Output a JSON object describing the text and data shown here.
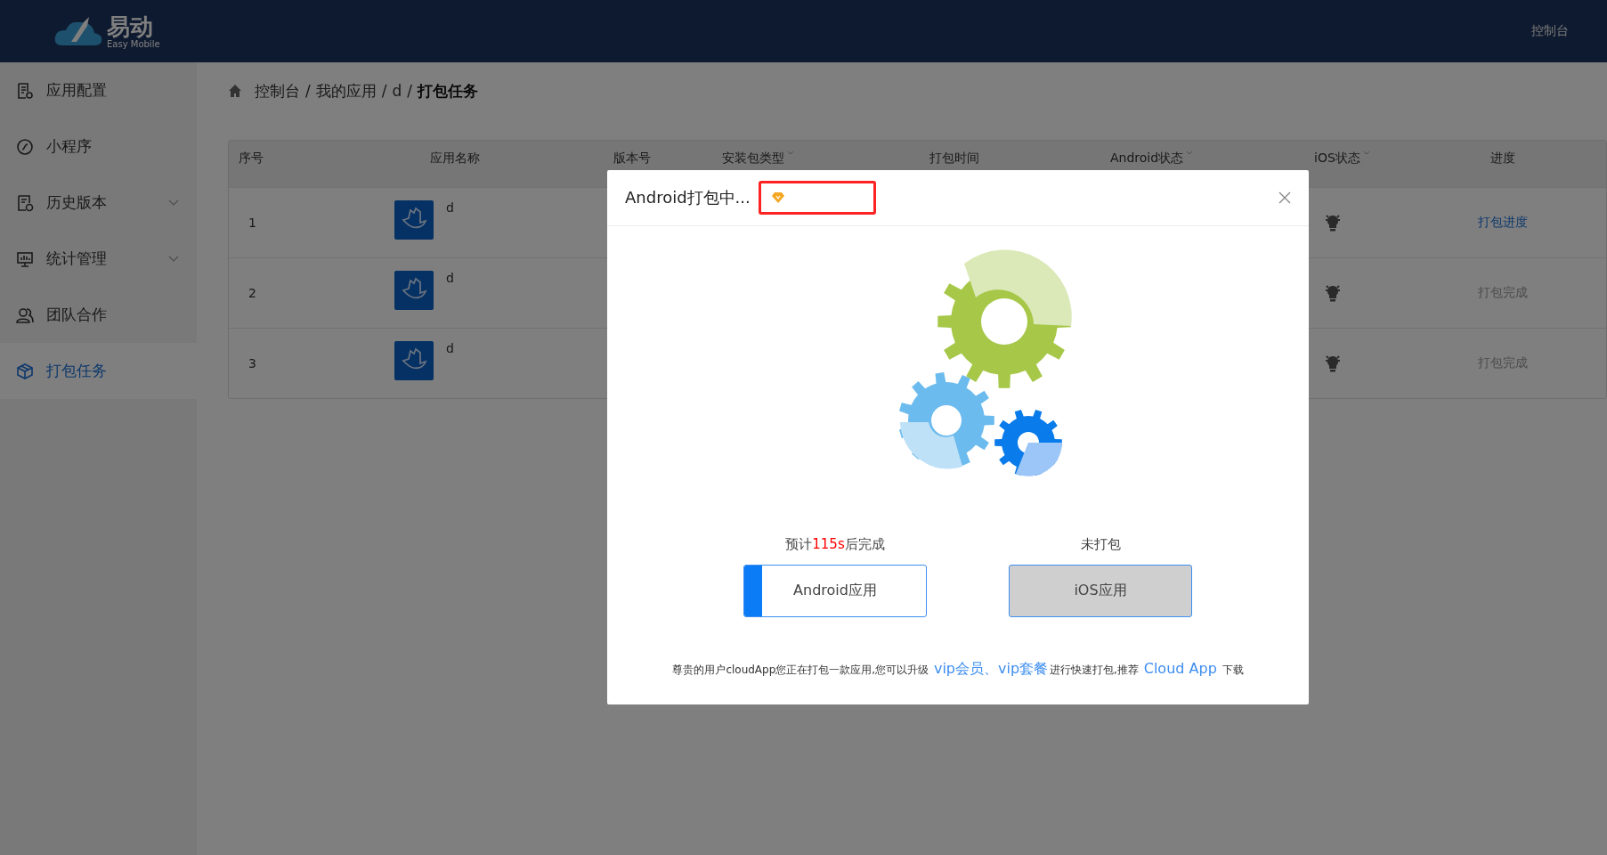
{
  "header": {
    "logo_title": "易动",
    "logo_subtitle": "Easy Mobile",
    "nav": [
      "控制台"
    ]
  },
  "sidebar": {
    "items": [
      {
        "label": "应用配置",
        "expandable": false,
        "selected": false
      },
      {
        "label": "小程序",
        "expandable": false,
        "selected": false
      },
      {
        "label": "历史版本",
        "expandable": true,
        "selected": false
      },
      {
        "label": "统计管理",
        "expandable": true,
        "selected": false
      },
      {
        "label": "团队合作",
        "expandable": false,
        "selected": false
      },
      {
        "label": "打包任务",
        "expandable": false,
        "selected": true
      }
    ]
  },
  "breadcrumb": {
    "separator": "/",
    "items": [
      "控制台",
      "我的应用",
      "d"
    ],
    "current": "打包任务"
  },
  "table": {
    "columns": [
      {
        "label": "序号",
        "sortable": false
      },
      {
        "label": "应用名称",
        "sortable": false
      },
      {
        "label": "版本号",
        "sortable": false
      },
      {
        "label": "安装包类型",
        "sortable": true
      },
      {
        "label": "打包时间",
        "sortable": false
      },
      {
        "label": "Android状态",
        "sortable": true
      },
      {
        "label": "iOS状态",
        "sortable": true
      },
      {
        "label": "进度",
        "sortable": false
      }
    ],
    "rows": [
      {
        "index": "1",
        "app_name": "d",
        "progress": "打包进度",
        "kind": "link"
      },
      {
        "index": "2",
        "app_name": "d",
        "progress": "打包完成",
        "kind": "done"
      },
      {
        "index": "3",
        "app_name": "d",
        "progress": "打包完成",
        "kind": "done"
      }
    ]
  },
  "modal": {
    "title": "Android打包中...",
    "vip_highlighted": true,
    "platforms": [
      {
        "status": [
          {
            "text": "预计",
            "kind": "plain"
          },
          {
            "text": "115s",
            "kind": "highlight"
          },
          {
            "text": "后完成",
            "kind": "plain"
          }
        ],
        "label": "Android应用",
        "level": 0.1,
        "disabled": false
      },
      {
        "status": [
          {
            "text": "未打包",
            "kind": "plain"
          }
        ],
        "label": "iOS应用",
        "disabled": true
      }
    ],
    "footer": [
      {
        "text": "尊贵的用户cloudApp您正在打包一款应用,您可以升级 ",
        "kind": "text"
      },
      {
        "text": "vip会员、vip套餐",
        "kind": "link"
      },
      {
        "text": "进行快速打包,推荐 ",
        "kind": "text"
      },
      {
        "text": "Cloud App",
        "kind": "link"
      },
      {
        "text": " 下载",
        "kind": "text"
      }
    ]
  }
}
